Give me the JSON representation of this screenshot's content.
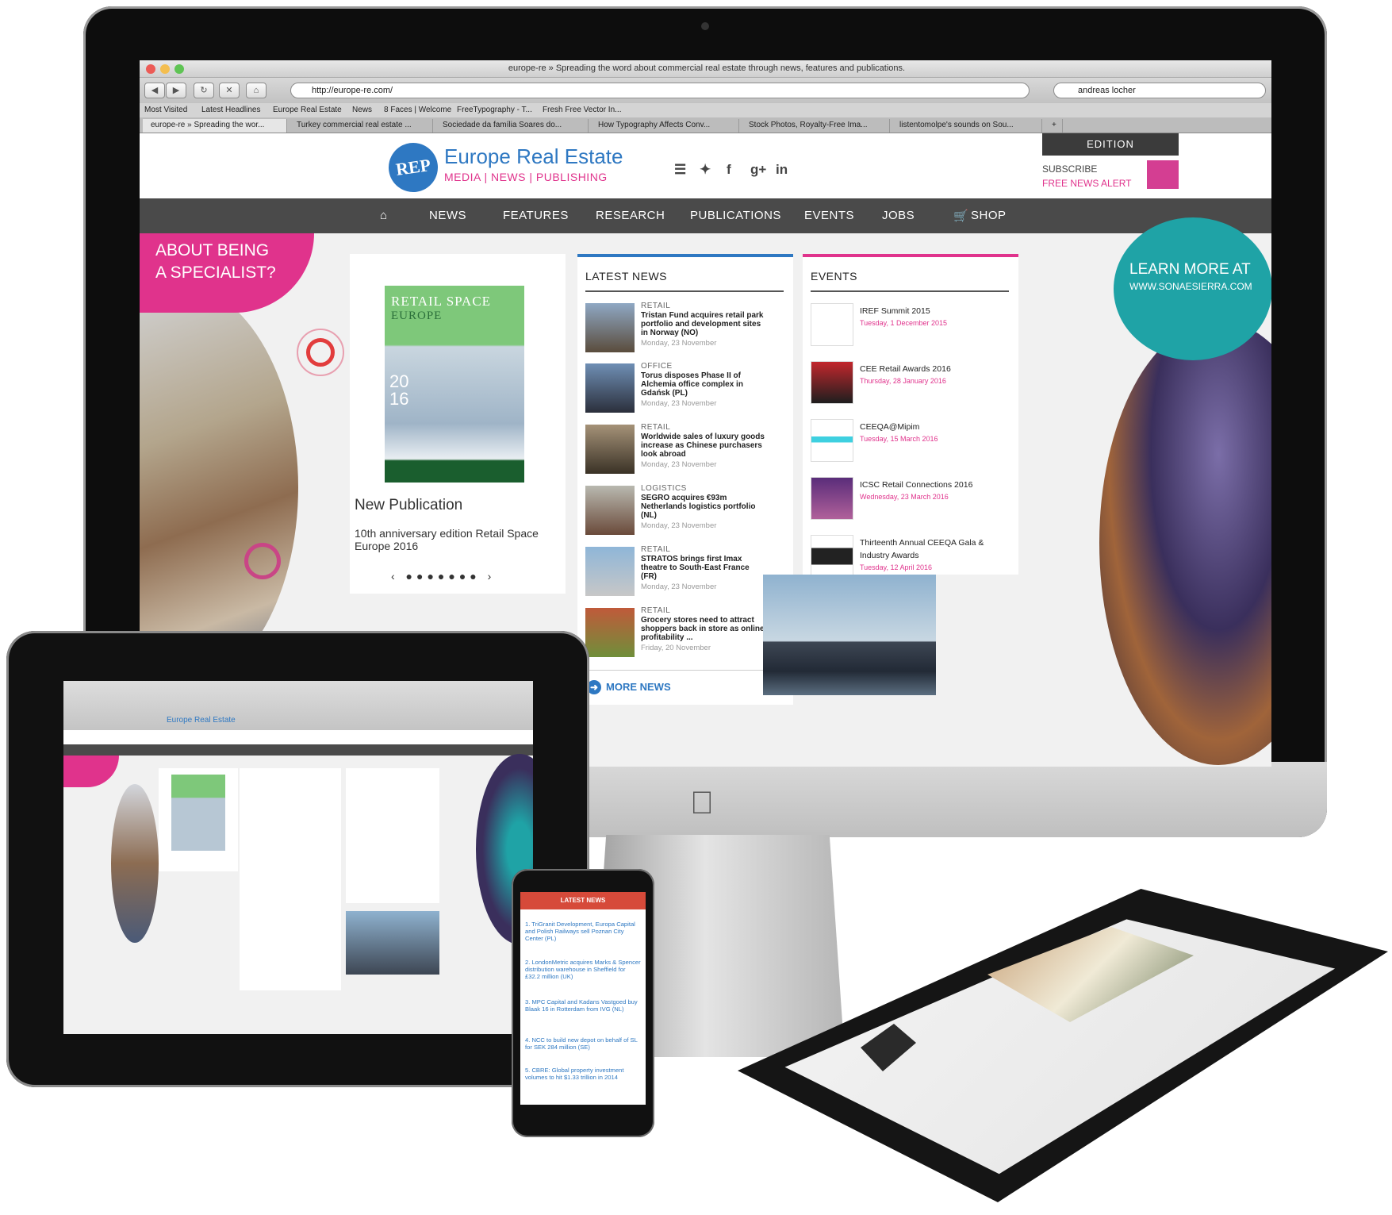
{
  "browser": {
    "window_title": "europe-re » Spreading the word about commercial real estate through news, features and publications.",
    "url": "http://europe-re.com/",
    "search_text": "andreas locher",
    "bookmarks": [
      "Most Visited",
      "Latest Headlines",
      "Europe Real Estate",
      "News",
      "8 Faces | Welcome",
      "FreeTypography - T...",
      "Fresh Free Vector In..."
    ],
    "tabs": [
      "europe-re » Spreading the wor...",
      "Turkey commercial real estate ...",
      "Sociedade da família Soares do...",
      "How Typography Affects Conv...",
      "Stock Photos, Royalty-Free Ima...",
      "listentomolpe's sounds on Sou..."
    ],
    "new_tab": "+"
  },
  "site": {
    "logo_badge": "REP",
    "logo_title": "Europe Real Estate",
    "logo_sub": "MEDIA | NEWS | PUBLISHING",
    "social_icons": [
      "rss-icon",
      "twitter-icon",
      "facebook-icon",
      "google-plus-icon",
      "linkedin-icon"
    ],
    "edition": "EDITION",
    "subscribe": "SUBSCRIBE",
    "free_alert": "FREE NEWS ALERT",
    "nav": [
      "NEWS",
      "FEATURES",
      "RESEARCH",
      "PUBLICATIONS",
      "EVENTS",
      "JOBS",
      "SHOP"
    ],
    "promo_left": [
      "ABOUT BEING",
      "A SPECIALIST?"
    ],
    "promo_right": "LEARN MORE AT",
    "promo_right_url": "WWW.SONAESIERRA.COM",
    "cover": {
      "line1": "RETAIL SPACE",
      "line2": "EUROPE",
      "year_top": "20",
      "year_bottom": "16"
    },
    "publication_heading": "New Publication",
    "publication_caption": "10th anniversary edition Retail Space Europe 2016",
    "latest_news": {
      "heading": "LATEST NEWS",
      "items": [
        {
          "cat": "RETAIL",
          "title": "Tristan Fund acquires retail park portfolio and development sites in Norway (NO)",
          "date": "Monday, 23 November"
        },
        {
          "cat": "OFFICE",
          "title": "Torus disposes Phase II of Alchemia office complex in Gdańsk (PL)",
          "date": "Monday, 23 November"
        },
        {
          "cat": "RETAIL",
          "title": "Worldwide sales of luxury goods increase as Chinese purchasers look abroad",
          "date": "Monday, 23 November"
        },
        {
          "cat": "LOGISTICS",
          "title": "SEGRO acquires €93m Netherlands logistics portfolio (NL)",
          "date": "Monday, 23 November"
        },
        {
          "cat": "RETAIL",
          "title": "STRATOS brings first Imax theatre to South-East France (FR)",
          "date": "Monday, 23 November"
        },
        {
          "cat": "RETAIL",
          "title": "Grocery stores need to attract shoppers back in store as online profitability ...",
          "date": "Friday, 20 November"
        }
      ],
      "more": "MORE NEWS"
    },
    "events": {
      "heading": "EVENTS",
      "items": [
        {
          "title": "IREF Summit 2015",
          "date": "Tuesday, 1 December 2015"
        },
        {
          "title": "CEE Retail Awards 2016",
          "date": "Thursday, 28 January 2016"
        },
        {
          "title": "CEEQA@Mipim",
          "date": "Tuesday, 15 March 2016"
        },
        {
          "title": "ICSC Retail Connections 2016",
          "date": "Wednesday, 23 March 2016"
        },
        {
          "title": "Thirteenth Annual CEEQA Gala & Industry Awards",
          "date": "Tuesday, 12 April 2016"
        }
      ]
    }
  },
  "phone": {
    "heading": "LATEST NEWS",
    "items": [
      "1.  TriGranit Development, Europa Capital and Polish Railways sell Poznan City Center (PL)",
      "2.  LondonMetric acquires Marks & Spencer distribution warehouse in Sheffield for £32.2 million (UK)",
      "3.  MPC Capital and Kadans Vastgoed buy Blaak 16 in Rotterdam from IVG (NL)",
      "4.  NCC to build new depot on behalf of SL for SEK 284 million (SE)",
      "5.  CBRE: Global property investment volumes to hit $1.33 trillion in 2014"
    ]
  },
  "colors": {
    "brand_blue": "#2e78c2",
    "brand_pink": "#e0338c",
    "teal": "#1fa3a6",
    "nav_dark": "#4a4a4a"
  }
}
